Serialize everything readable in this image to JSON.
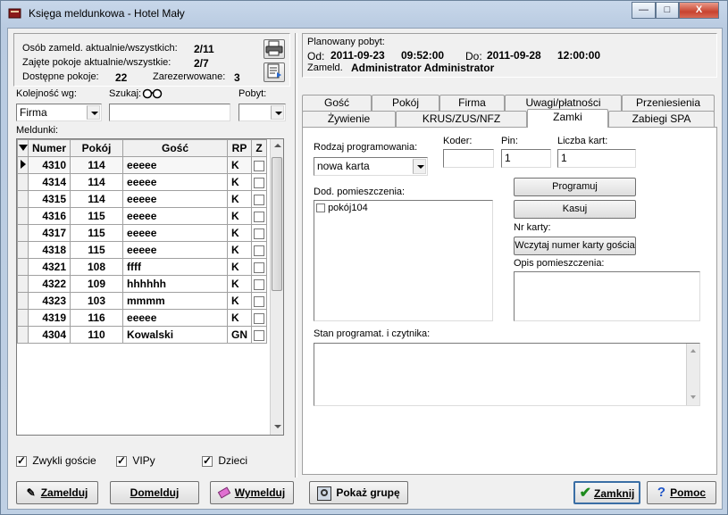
{
  "window": {
    "title": "Księga meldunkowa - Hotel Mały",
    "buttons": {
      "minimize": "—",
      "maximize": "□",
      "close": "X"
    }
  },
  "stats": {
    "guests_label": "Osób zameld. aktualnie/wszystkich:",
    "guests_value": "2/11",
    "rooms_label": "Zajęte pokoje aktualnie/wszystkie:",
    "rooms_value": "2/7",
    "available_label": "Dostępne pokoje:",
    "available_value": "22",
    "reserved_label": "Zarezerwowane:",
    "reserved_value": "3"
  },
  "filters": {
    "order_label": "Kolejność wg:",
    "order_value": "Firma",
    "search_label": "Szukaj:",
    "search_value": "",
    "stay_label": "Pobyt:",
    "stay_value": ""
  },
  "meldunki": {
    "label": "Meldunki:",
    "columns": [
      "Numer",
      "Pokój",
      "Gość",
      "RP",
      "Z"
    ],
    "rows": [
      {
        "numer": "4310",
        "pokoj": "114",
        "gosc": "eeeee",
        "rp": "K"
      },
      {
        "numer": "4314",
        "pokoj": "114",
        "gosc": "eeeee",
        "rp": "K"
      },
      {
        "numer": "4315",
        "pokoj": "114",
        "gosc": "eeeee",
        "rp": "K"
      },
      {
        "numer": "4316",
        "pokoj": "115",
        "gosc": "eeeee",
        "rp": "K"
      },
      {
        "numer": "4317",
        "pokoj": "115",
        "gosc": "eeeee",
        "rp": "K"
      },
      {
        "numer": "4318",
        "pokoj": "115",
        "gosc": "eeeee",
        "rp": "K"
      },
      {
        "numer": "4321",
        "pokoj": "108",
        "gosc": "ffff",
        "rp": "K"
      },
      {
        "numer": "4322",
        "pokoj": "109",
        "gosc": "hhhhhh",
        "rp": "K"
      },
      {
        "numer": "4323",
        "pokoj": "103",
        "gosc": "mmmm",
        "rp": "K"
      },
      {
        "numer": "4319",
        "pokoj": "116",
        "gosc": "eeeee",
        "rp": "K"
      },
      {
        "numer": "4304",
        "pokoj": "110",
        "gosc": "Kowalski",
        "rp": "GN"
      }
    ]
  },
  "guest_filters": {
    "regular": "Zwykli goście",
    "vip": "VIPy",
    "children": "Dzieci"
  },
  "stay": {
    "planned_label": "Planowany pobyt:",
    "from_label": "Od:",
    "from_date": "2011-09-23",
    "from_time": "09:52:00",
    "to_label": "Do:",
    "to_date": "2011-09-28",
    "to_time": "12:00:00",
    "registered_label": "Zameld.",
    "registered_by": "Administrator Administrator"
  },
  "tabs_row1": [
    "Gość",
    "Pokój",
    "Firma",
    "Uwagi/płatności",
    "Przeniesienia"
  ],
  "tabs_row2": [
    "Żywienie",
    "KRUS/ZUS/NFZ",
    "Zamki",
    "Zabiegi SPA"
  ],
  "zamki": {
    "programming_type_label": "Rodzaj programowania:",
    "programming_type_value": "nowa karta",
    "coder_label": "Koder:",
    "coder_value": "",
    "pin_label": "Pin:",
    "pin_value": "1",
    "cards_label": "Liczba kart:",
    "cards_value": "1",
    "extra_rooms_label": "Dod. pomieszczenia:",
    "extra_rooms": [
      "pokój104"
    ],
    "program_btn": "Programuj",
    "delete_btn": "Kasuj",
    "card_no_label": "Nr karty:",
    "read_card_btn": "Wczytaj numer karty gościa",
    "room_desc_label": "Opis pomieszczenia:",
    "status_label": "Stan programat. i czytnika:"
  },
  "bottom_buttons": {
    "zamelduj": "Zamelduj",
    "domelduj": "Domelduj",
    "wymelduj": "Wymelduj",
    "pokaz_grupe": "Pokaż grupę",
    "zamknij": "Zamknij",
    "pomoc": "Pomoc"
  }
}
